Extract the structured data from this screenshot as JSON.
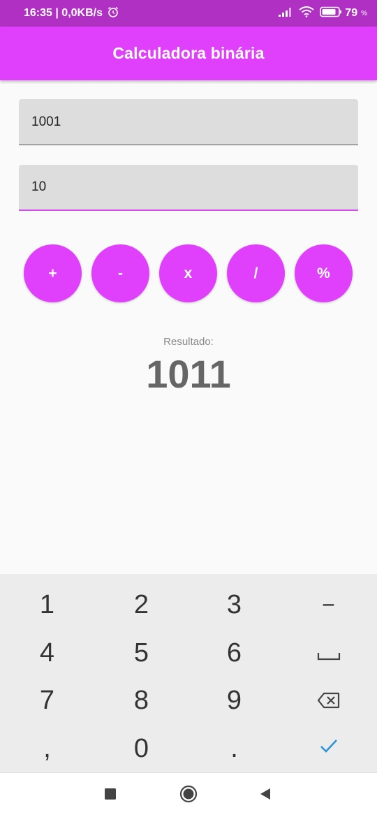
{
  "status_bar": {
    "time_info": "16:35 | 0,0KB/s",
    "battery_pct": "79",
    "battery_unit": "%"
  },
  "app_bar": {
    "title": "Calculadora binária"
  },
  "inputs": {
    "first": "1001",
    "second": "10"
  },
  "operators": [
    "+",
    "-",
    "x",
    "/",
    "%"
  ],
  "result": {
    "label": "Resultado:",
    "value": "1011"
  },
  "keyboard": {
    "rows": [
      [
        "1",
        "2",
        "3",
        "−"
      ],
      [
        "4",
        "5",
        "6",
        "space"
      ],
      [
        "7",
        "8",
        "9",
        "backspace"
      ],
      [
        ",",
        "0",
        ".",
        "done"
      ]
    ],
    "keys": {
      "k1": "1",
      "k2": "2",
      "k3": "3",
      "minus": "−",
      "k4": "4",
      "k5": "5",
      "k6": "6",
      "k7": "7",
      "k8": "8",
      "k9": "9",
      "comma": ",",
      "k0": "0",
      "period": "."
    }
  },
  "colors": {
    "status_bar": "#b030c4",
    "accent": "#e040fb",
    "keyboard_bg": "#ececec",
    "check": "#2a96d8"
  },
  "icons": {
    "status_left": "alarm-clock-icon",
    "status_right": [
      "signal-icon",
      "wifi-icon",
      "battery-icon"
    ],
    "keyboard_special": [
      "space-bar-icon",
      "backspace-icon",
      "check-icon"
    ],
    "nav": [
      "recents-square-icon",
      "home-circle-icon",
      "back-triangle-icon"
    ]
  }
}
